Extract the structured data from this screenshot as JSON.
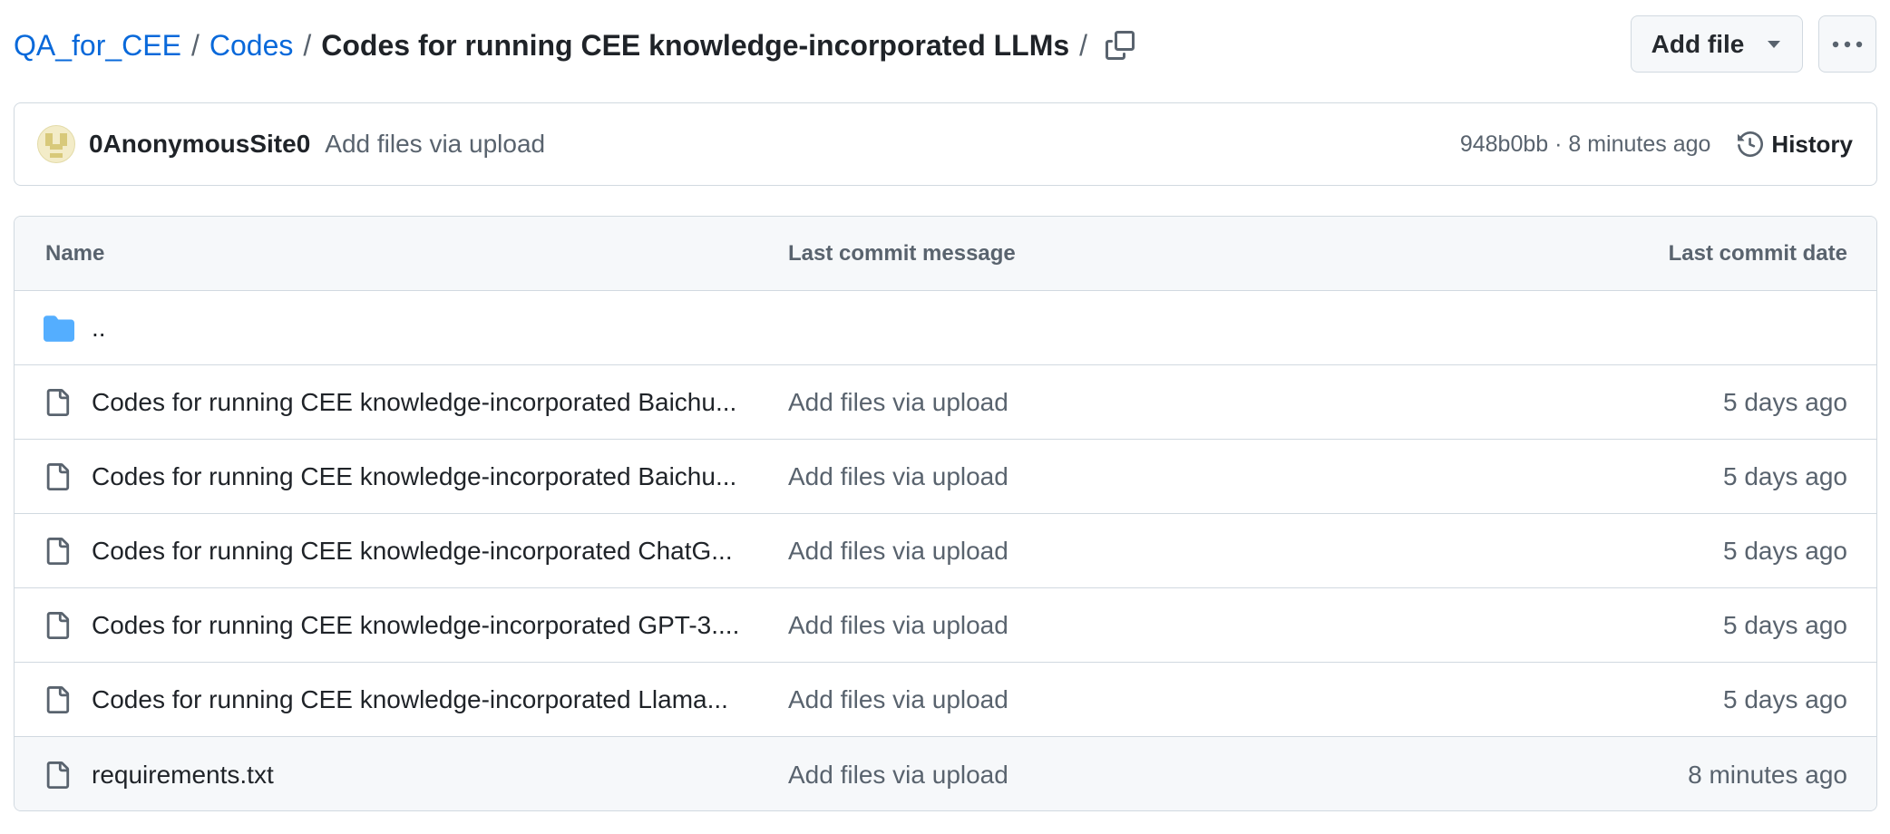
{
  "breadcrumb": {
    "repo": "QA_for_CEE",
    "folder": "Codes",
    "current": "Codes for running CEE knowledge-incorporated LLMs",
    "separator": "/"
  },
  "actions": {
    "add_file_label": "Add file"
  },
  "latest_commit": {
    "author": "0AnonymousSite0",
    "message": "Add files via upload",
    "meta": "948b0bb · 8 minutes ago",
    "history_label": "History"
  },
  "table": {
    "headers": {
      "name": "Name",
      "message": "Last commit message",
      "date": "Last commit date"
    },
    "parent": "..",
    "rows": [
      {
        "name": "Codes for running CEE knowledge-incorporated Baichu...",
        "message": "Add files via upload",
        "date": "5 days ago"
      },
      {
        "name": "Codes for running CEE knowledge-incorporated Baichu...",
        "message": "Add files via upload",
        "date": "5 days ago"
      },
      {
        "name": "Codes for running CEE knowledge-incorporated ChatG...",
        "message": "Add files via upload",
        "date": "5 days ago"
      },
      {
        "name": "Codes for running CEE knowledge-incorporated GPT-3....",
        "message": "Add files via upload",
        "date": "5 days ago"
      },
      {
        "name": "Codes for running CEE knowledge-incorporated Llama...",
        "message": "Add files via upload",
        "date": "5 days ago"
      },
      {
        "name": "requirements.txt",
        "message": "Add files via upload",
        "date": "8 minutes ago"
      }
    ]
  },
  "icons": {
    "copy": "copy-icon",
    "caret": "triangle-down-icon",
    "more": "kebab-horizontal-icon",
    "history": "history-icon",
    "folder": "folder-icon",
    "file": "file-icon"
  },
  "colors": {
    "link": "#0969da",
    "muted": "#59636e",
    "border": "#d1d9e0",
    "folder": "#54aeff"
  }
}
